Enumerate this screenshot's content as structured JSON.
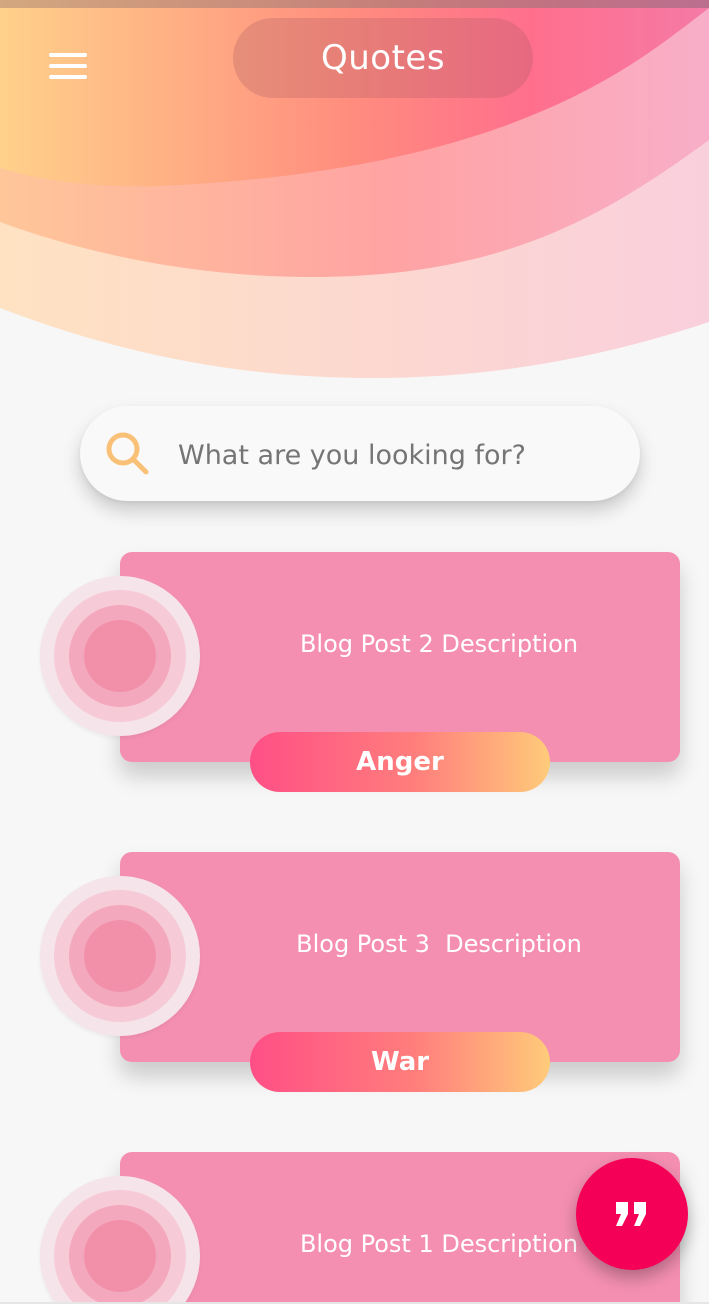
{
  "header": {
    "title": "Quotes",
    "menu_icon": "hamburger-menu-icon"
  },
  "search": {
    "placeholder": "What are you looking for?",
    "value": "",
    "icon": "search-icon"
  },
  "posts": [
    {
      "description": "Blog Post 2 Description",
      "tag": "Anger"
    },
    {
      "description": "Blog Post 3  Description",
      "tag": "War"
    },
    {
      "description": "Blog Post 1 Description",
      "tag": ""
    }
  ],
  "fab": {
    "icon": "quote-icon"
  },
  "colors": {
    "card": "#f48fb1",
    "fab": "#f50057",
    "tag_gradient_start": "#ff4f86",
    "tag_gradient_end": "#ffcb7a",
    "search_icon": "#f9c178",
    "background": "#f7f7f7"
  }
}
